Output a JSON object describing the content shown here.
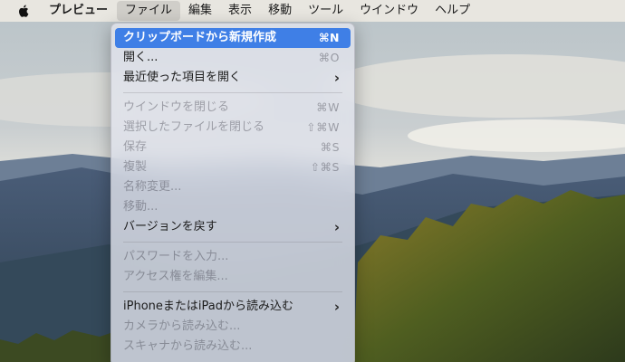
{
  "menubar": {
    "app_name": "プレビュー",
    "menus": [
      {
        "label": "ファイル",
        "active": true
      },
      {
        "label": "編集",
        "active": false
      },
      {
        "label": "表示",
        "active": false
      },
      {
        "label": "移動",
        "active": false
      },
      {
        "label": "ツール",
        "active": false
      },
      {
        "label": "ウインドウ",
        "active": false
      },
      {
        "label": "ヘルプ",
        "active": false
      }
    ]
  },
  "file_menu": {
    "items": [
      {
        "label": "クリップボードから新規作成",
        "shortcut": "⌘N",
        "state": "highlighted"
      },
      {
        "label": "開く...",
        "shortcut": "⌘O",
        "state": "enabled"
      },
      {
        "label": "最近使った項目を開く",
        "submenu": true,
        "state": "enabled"
      },
      {
        "label": "ウインドウを閉じる",
        "shortcut": "⌘W",
        "state": "disabled"
      },
      {
        "label": "選択したファイルを閉じる",
        "shortcut": "⇧⌘W",
        "state": "disabled"
      },
      {
        "label": "保存",
        "shortcut": "⌘S",
        "state": "disabled"
      },
      {
        "label": "複製",
        "shortcut": "⇧⌘S",
        "state": "disabled"
      },
      {
        "label": "名称変更...",
        "state": "disabled"
      },
      {
        "label": "移動...",
        "state": "disabled"
      },
      {
        "label": "バージョンを戻す",
        "submenu": true,
        "state": "enabled"
      },
      {
        "label": "パスワードを入力...",
        "state": "disabled"
      },
      {
        "label": "アクセス権を編集...",
        "state": "disabled"
      },
      {
        "label": "iPhoneまたはiPadから読み込む",
        "submenu": true,
        "state": "enabled"
      },
      {
        "label": "カメラから読み込む...",
        "state": "disabled"
      },
      {
        "label": "スキャナから読み込む...",
        "state": "disabled"
      }
    ]
  },
  "colors": {
    "highlight": "#3f7fe6",
    "menubar_bg": "#ece8e2"
  }
}
